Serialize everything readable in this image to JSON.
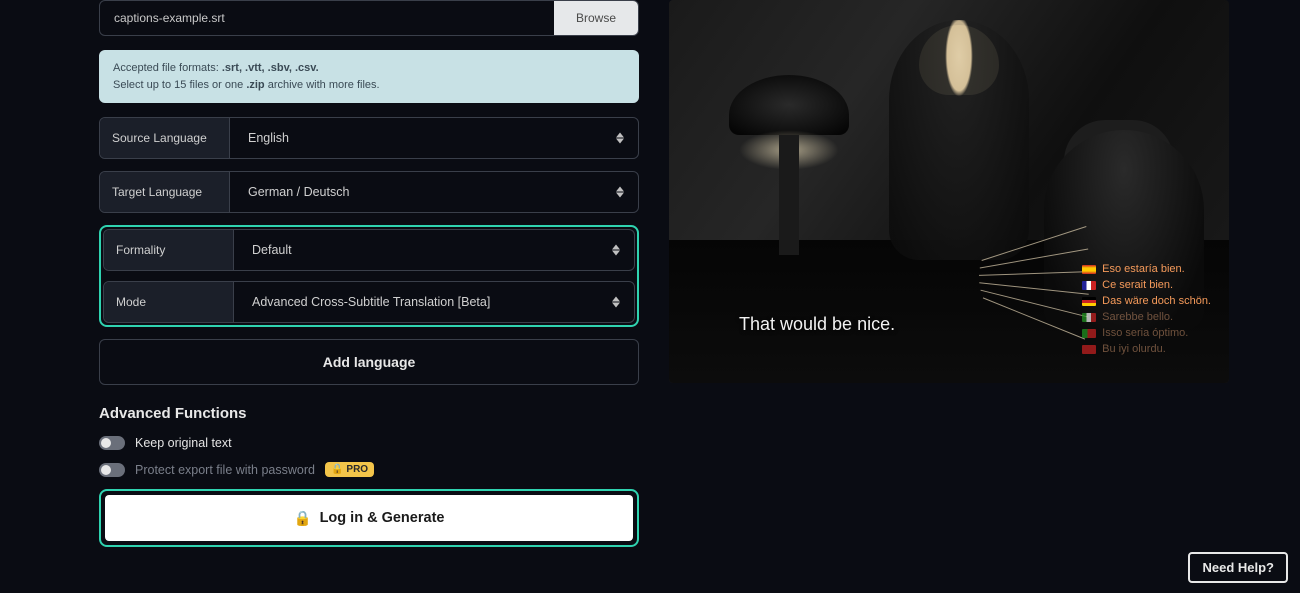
{
  "file": {
    "name": "captions-example.srt",
    "browse": "Browse"
  },
  "info": {
    "line1_prefix": "Accepted file formats: ",
    "line1_formats": ".srt, .vtt, .sbv, .csv.",
    "line2_prefix": "Select up to 15 files or one ",
    "line2_bold": ".zip",
    "line2_suffix": " archive with more files."
  },
  "selects": {
    "source": {
      "label": "Source Language",
      "value": "English"
    },
    "target": {
      "label": "Target Language",
      "value": "German / Deutsch"
    },
    "formality": {
      "label": "Formality",
      "value": "Default"
    },
    "mode": {
      "label": "Mode",
      "value": "Advanced Cross-Subtitle Translation [Beta]"
    }
  },
  "addLanguage": "Add language",
  "advanced": {
    "title": "Advanced Functions",
    "keepOriginal": "Keep original text",
    "protect": "Protect export file with password",
    "proBadge": "PRO"
  },
  "generate": "Log in & Generate",
  "preview": {
    "caption": "That would be nice.",
    "translations": [
      {
        "flag": "es",
        "text": "Eso estaría bien."
      },
      {
        "flag": "fr",
        "text": "Ce serait bien."
      },
      {
        "flag": "de",
        "text": "Das wäre doch schön."
      },
      {
        "flag": "it",
        "text": "Sarebbe bello."
      },
      {
        "flag": "pt",
        "text": "Isso seria óptimo."
      },
      {
        "flag": "tr",
        "text": "Bu iyi olurdu."
      }
    ]
  },
  "help": "Need Help?"
}
